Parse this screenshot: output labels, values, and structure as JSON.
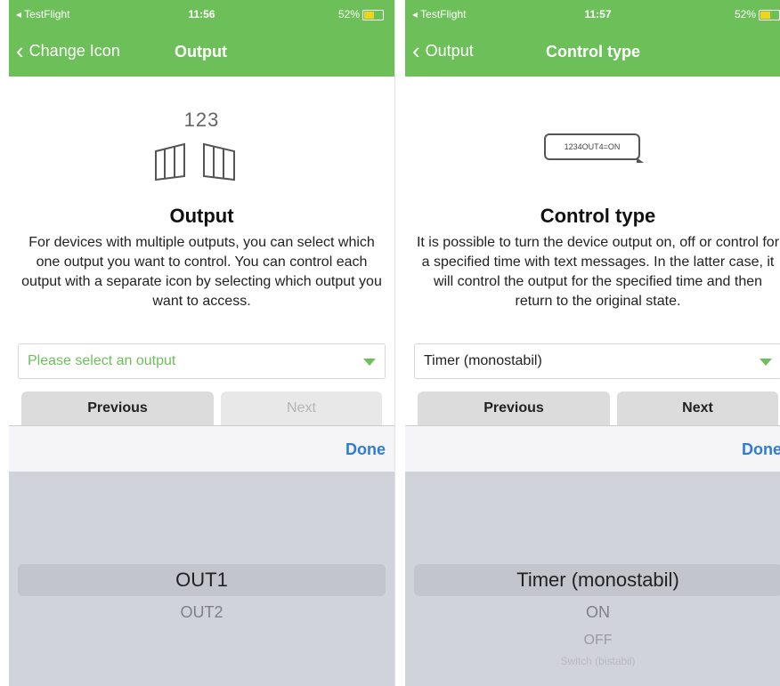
{
  "left_screen": {
    "status": {
      "carrier": "◂ TestFlight",
      "time": "11:56",
      "battery": "52%"
    },
    "nav": {
      "back_label": "Change Icon",
      "title": "Output"
    },
    "illustration_text": "123",
    "heading": "Output",
    "description": "For devices with multiple outputs, you can select which one output you want to control. You can control each output with a separate icon by selecting which output you want to access.",
    "select": {
      "value": "Please select an output"
    },
    "buttons": {
      "previous": "Previous",
      "next": "Next"
    },
    "done": "Done",
    "picker": {
      "selected": "OUT1",
      "options": [
        "OUT2"
      ]
    }
  },
  "right_screen": {
    "status": {
      "carrier": "◂ TestFlight",
      "time": "11:57",
      "battery": "52%"
    },
    "nav": {
      "back_label": "Output",
      "title": "Control type"
    },
    "bubble_text": "1234OUT4=ON",
    "heading": "Control type",
    "description": "It is possible to turn the device output on, off or control for a specified time with text messages. In the latter case, it will control the output for the specified time and then return to the original state.",
    "select": {
      "value": "Timer (monostabil)"
    },
    "buttons": {
      "previous": "Previous",
      "next": "Next"
    },
    "done": "Done",
    "picker": {
      "selected": "Timer (monostabil)",
      "options": [
        "ON",
        "OFF",
        "Switch (bistabil)"
      ]
    }
  },
  "colors": {
    "accent": "#6dbf5a",
    "link": "#2f7bd8",
    "picker_bg": "#d0d3d9"
  }
}
